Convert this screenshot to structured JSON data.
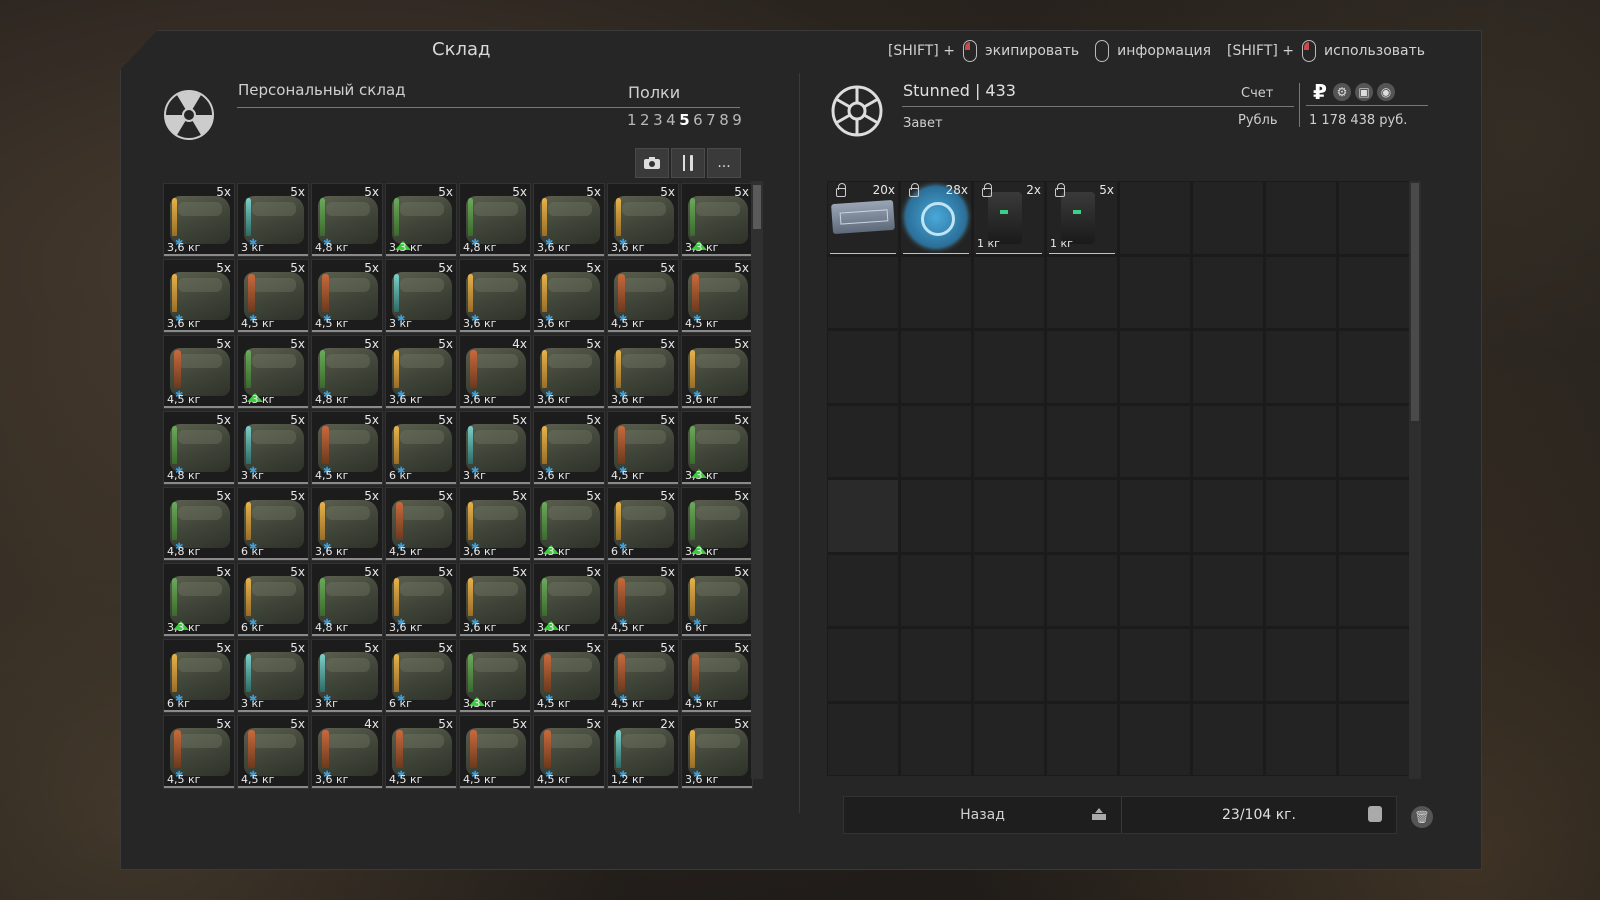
{
  "window": {
    "title": "Склад"
  },
  "hints": [
    {
      "prefix": "[SHIFT] +",
      "mouse": "left",
      "label": "экипировать"
    },
    {
      "prefix": "",
      "mouse": "right",
      "label": "информация"
    },
    {
      "prefix": "[SHIFT] +",
      "mouse": "left",
      "label": "использовать"
    }
  ],
  "storage": {
    "label": "Персональный склад",
    "shelves_label": "Полки",
    "shelves": [
      "1",
      "2",
      "3",
      "4",
      "5",
      "6",
      "7",
      "8",
      "9"
    ],
    "active_shelf": "5",
    "tools": [
      "camera-icon",
      "sort-icon",
      "..."
    ]
  },
  "left_items": [
    {
      "qty": "5x",
      "wt": "3,6 кг",
      "c": "",
      "b": "blue"
    },
    {
      "qty": "5x",
      "wt": "3 кг",
      "c": "teal",
      "b": "blue"
    },
    {
      "qty": "5x",
      "wt": "4,8 кг",
      "c": "green",
      "b": "blue"
    },
    {
      "qty": "5x",
      "wt": "3,3 кг",
      "c": "green",
      "b": "green"
    },
    {
      "qty": "5x",
      "wt": "4,8 кг",
      "c": "green",
      "b": "blue"
    },
    {
      "qty": "5x",
      "wt": "3,6 кг",
      "c": "",
      "b": "blue"
    },
    {
      "qty": "5x",
      "wt": "3,6 кг",
      "c": "",
      "b": "blue"
    },
    {
      "qty": "5x",
      "wt": "3,3 кг",
      "c": "green",
      "b": "green"
    },
    {
      "qty": "5x",
      "wt": "3,6 кг",
      "c": "",
      "b": "blue"
    },
    {
      "qty": "5x",
      "wt": "4,5 кг",
      "c": "red",
      "b": "blue"
    },
    {
      "qty": "5x",
      "wt": "4,5 кг",
      "c": "red",
      "b": "blue"
    },
    {
      "qty": "5x",
      "wt": "3 кг",
      "c": "teal",
      "b": "blue"
    },
    {
      "qty": "5x",
      "wt": "3,6 кг",
      "c": "",
      "b": "blue"
    },
    {
      "qty": "5x",
      "wt": "3,6 кг",
      "c": "",
      "b": "blue"
    },
    {
      "qty": "5x",
      "wt": "4,5 кг",
      "c": "red",
      "b": "blue"
    },
    {
      "qty": "5x",
      "wt": "4,5 кг",
      "c": "red",
      "b": "blue"
    },
    {
      "qty": "5x",
      "wt": "4,5 кг",
      "c": "red",
      "b": "blue"
    },
    {
      "qty": "5x",
      "wt": "3,3 кг",
      "c": "green",
      "b": "green"
    },
    {
      "qty": "5x",
      "wt": "4,8 кг",
      "c": "green",
      "b": "blue"
    },
    {
      "qty": "5x",
      "wt": "3,6 кг",
      "c": "",
      "b": "blue"
    },
    {
      "qty": "4x",
      "wt": "3,6 кг",
      "c": "red",
      "b": "blue"
    },
    {
      "qty": "5x",
      "wt": "3,6 кг",
      "c": "",
      "b": "blue"
    },
    {
      "qty": "5x",
      "wt": "3,6 кг",
      "c": "",
      "b": "blue"
    },
    {
      "qty": "5x",
      "wt": "3,6 кг",
      "c": "",
      "b": "blue"
    },
    {
      "qty": "5x",
      "wt": "4,8 кг",
      "c": "green",
      "b": "blue"
    },
    {
      "qty": "5x",
      "wt": "3 кг",
      "c": "teal",
      "b": "blue"
    },
    {
      "qty": "5x",
      "wt": "4,5 кг",
      "c": "red",
      "b": "blue"
    },
    {
      "qty": "5x",
      "wt": "6 кг",
      "c": "",
      "b": "blue"
    },
    {
      "qty": "5x",
      "wt": "3 кг",
      "c": "teal",
      "b": "blue"
    },
    {
      "qty": "5x",
      "wt": "3,6 кг",
      "c": "",
      "b": "blue"
    },
    {
      "qty": "5x",
      "wt": "4,5 кг",
      "c": "red",
      "b": "blue"
    },
    {
      "qty": "5x",
      "wt": "3,3 кг",
      "c": "green",
      "b": "green"
    },
    {
      "qty": "5x",
      "wt": "4,8 кг",
      "c": "green",
      "b": "blue"
    },
    {
      "qty": "5x",
      "wt": "6 кг",
      "c": "",
      "b": "blue"
    },
    {
      "qty": "5x",
      "wt": "3,6 кг",
      "c": "",
      "b": "blue"
    },
    {
      "qty": "5x",
      "wt": "4,5 кг",
      "c": "red",
      "b": "blue"
    },
    {
      "qty": "5x",
      "wt": "3,6 кг",
      "c": "",
      "b": "blue"
    },
    {
      "qty": "5x",
      "wt": "3,3 кг",
      "c": "green",
      "b": "green"
    },
    {
      "qty": "5x",
      "wt": "6 кг",
      "c": "",
      "b": "blue"
    },
    {
      "qty": "5x",
      "wt": "3,3 кг",
      "c": "green",
      "b": "green"
    },
    {
      "qty": "5x",
      "wt": "3,3 кг",
      "c": "green",
      "b": "green"
    },
    {
      "qty": "5x",
      "wt": "6 кг",
      "c": "",
      "b": "blue"
    },
    {
      "qty": "5x",
      "wt": "4,8 кг",
      "c": "green",
      "b": "blue"
    },
    {
      "qty": "5x",
      "wt": "3,6 кг",
      "c": "",
      "b": "blue"
    },
    {
      "qty": "5x",
      "wt": "3,6 кг",
      "c": "",
      "b": "blue"
    },
    {
      "qty": "5x",
      "wt": "3,3 кг",
      "c": "green",
      "b": "green"
    },
    {
      "qty": "5x",
      "wt": "4,5 кг",
      "c": "red",
      "b": "blue"
    },
    {
      "qty": "5x",
      "wt": "6 кг",
      "c": "",
      "b": "blue"
    },
    {
      "qty": "5x",
      "wt": "6 кг",
      "c": "",
      "b": "blue"
    },
    {
      "qty": "5x",
      "wt": "3 кг",
      "c": "teal",
      "b": "blue"
    },
    {
      "qty": "5x",
      "wt": "3 кг",
      "c": "teal",
      "b": "blue"
    },
    {
      "qty": "5x",
      "wt": "6 кг",
      "c": "",
      "b": "blue"
    },
    {
      "qty": "5x",
      "wt": "3,3 кг",
      "c": "green",
      "b": "green"
    },
    {
      "qty": "5x",
      "wt": "4,5 кг",
      "c": "red",
      "b": "blue"
    },
    {
      "qty": "5x",
      "wt": "4,5 кг",
      "c": "red",
      "b": "blue"
    },
    {
      "qty": "5x",
      "wt": "4,5 кг",
      "c": "red",
      "b": "blue"
    },
    {
      "qty": "5x",
      "wt": "4,5 кг",
      "c": "red",
      "b": "blue"
    },
    {
      "qty": "5x",
      "wt": "4,5 кг",
      "c": "red",
      "b": "blue"
    },
    {
      "qty": "4x",
      "wt": "3,6 кг",
      "c": "red",
      "b": "blue"
    },
    {
      "qty": "5x",
      "wt": "4,5 кг",
      "c": "red",
      "b": "blue"
    },
    {
      "qty": "5x",
      "wt": "4,5 кг",
      "c": "red",
      "b": "blue"
    },
    {
      "qty": "5x",
      "wt": "4,5 кг",
      "c": "red",
      "b": "blue"
    },
    {
      "qty": "2x",
      "wt": "1,2 кг",
      "c": "teal",
      "b": "blue"
    },
    {
      "qty": "5x",
      "wt": "3,6 кг",
      "c": "",
      "b": "blue"
    }
  ],
  "player": {
    "name": "Stunned",
    "level": "433",
    "faction": "Завет",
    "account_label": "Счет",
    "currency_label": "Рубль",
    "balance": "1 178 438 руб.",
    "currency_symbol": "₽"
  },
  "right_items": [
    {
      "qty": "20x",
      "wt": "",
      "kind": "plate",
      "locked": true
    },
    {
      "qty": "28x",
      "wt": "",
      "kind": "coin",
      "locked": true
    },
    {
      "qty": "2x",
      "wt": "1 кг",
      "kind": "device",
      "locked": true
    },
    {
      "qty": "5x",
      "wt": "1 кг",
      "kind": "device",
      "locked": true
    }
  ],
  "footer": {
    "back_label": "Назад",
    "weight": "23/104 кг."
  },
  "colors": {
    "panel": "#262626",
    "accent_blue": "#3aa0e0",
    "accent_green": "#3acc3a"
  }
}
